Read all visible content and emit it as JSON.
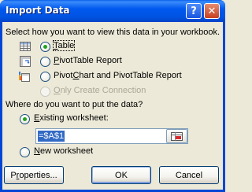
{
  "window": {
    "title": "Import Data",
    "help_label": "?",
    "close_label": "✕"
  },
  "view_section": {
    "heading": "Select how you want to view this data in your workbook.",
    "options": [
      {
        "label": "Table",
        "checked": true,
        "enabled": true,
        "icon": "table-icon"
      },
      {
        "label": "PivotTable Report",
        "checked": false,
        "enabled": true,
        "icon": "pivottable-icon"
      },
      {
        "label": "PivotChart and PivotTable Report",
        "checked": false,
        "enabled": true,
        "icon": "pivotchart-icon"
      },
      {
        "label": "Only Create Connection",
        "checked": false,
        "enabled": false,
        "icon": ""
      }
    ]
  },
  "location_section": {
    "heading": "Where do you want to put the data?",
    "existing_label": "Existing worksheet:",
    "existing_checked": true,
    "reference_value": "=$A$1",
    "new_label": "New worksheet",
    "new_checked": false
  },
  "buttons": {
    "properties": "Properties...",
    "ok": "OK",
    "cancel": "Cancel"
  },
  "colors": {
    "titlebar": "#0054e3",
    "dialog_bg": "#ece9d8",
    "selection": "#316ac5",
    "radio_dot": "#21a121"
  }
}
